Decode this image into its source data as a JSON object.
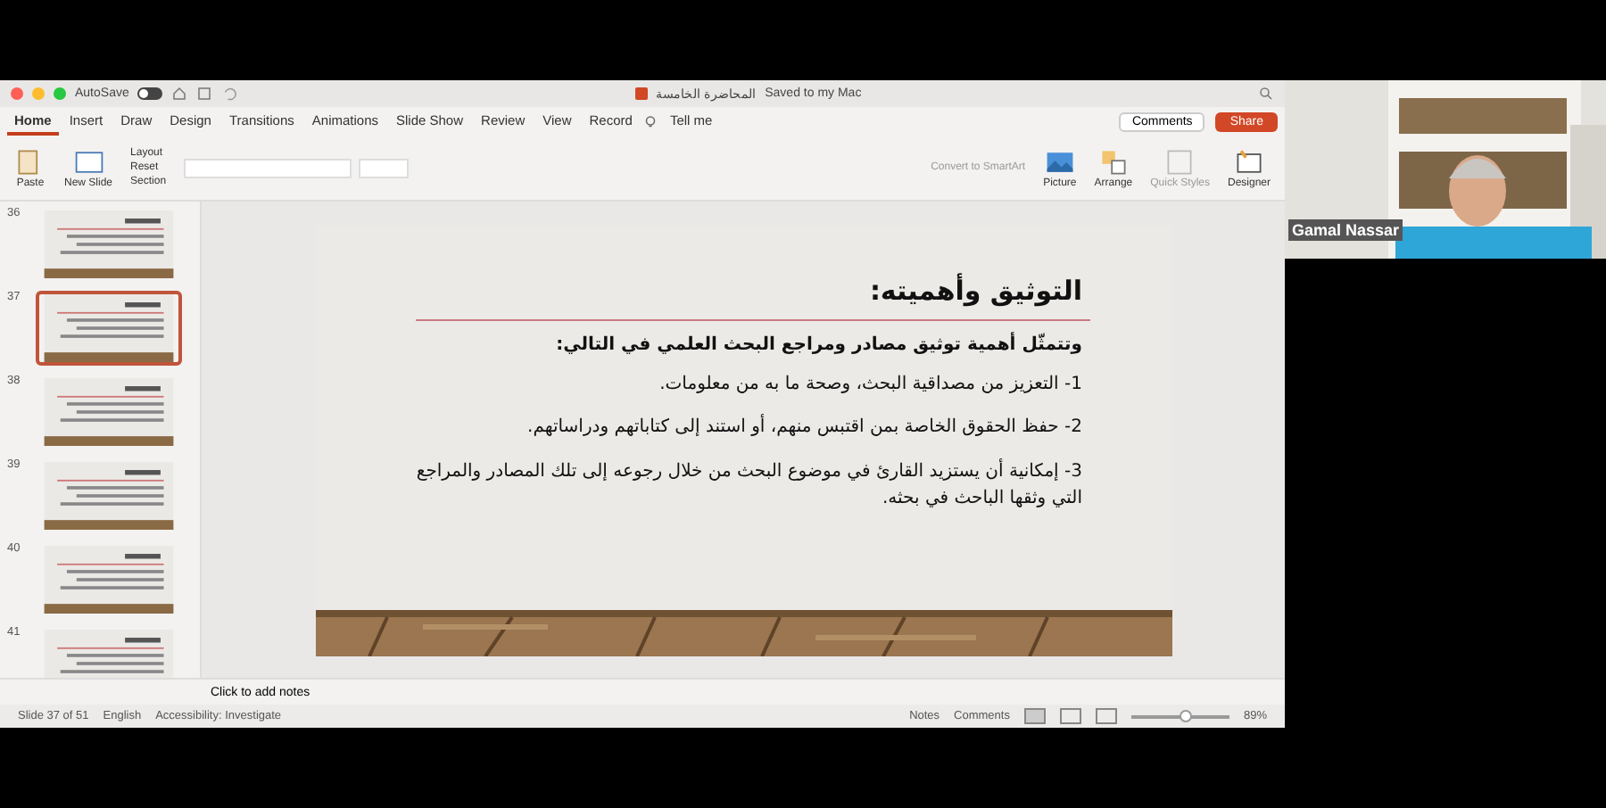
{
  "window": {
    "title": "المحاضرة الخامسة",
    "save_status": "Saved to my Mac",
    "autosave_label": "AutoSave",
    "autosave_on": false
  },
  "tabs": [
    {
      "label": "Home",
      "selected": true
    },
    {
      "label": "Insert",
      "selected": false
    },
    {
      "label": "Draw",
      "selected": false
    },
    {
      "label": "Design",
      "selected": false
    },
    {
      "label": "Transitions",
      "selected": false
    },
    {
      "label": "Animations",
      "selected": false
    },
    {
      "label": "Slide Show",
      "selected": false
    },
    {
      "label": "Review",
      "selected": false
    },
    {
      "label": "View",
      "selected": false
    },
    {
      "label": "Record",
      "selected": false
    }
  ],
  "tell_me": "Tell me",
  "comments_button": "Comments",
  "share_button": "Share",
  "ribbon": {
    "paste": "Paste",
    "new_slide": "New Slide",
    "slide_menu": [
      "Layout",
      "Reset",
      "Section"
    ],
    "smartart": "Convert to SmartArt",
    "picture": "Picture",
    "arrange": "Arrange",
    "quick_styles": "Quick Styles",
    "designer": "Designer"
  },
  "thumbnails": [
    {
      "number": "36",
      "selected": false
    },
    {
      "number": "37",
      "selected": true
    },
    {
      "number": "38",
      "selected": false
    },
    {
      "number": "39",
      "selected": false
    },
    {
      "number": "40",
      "selected": false
    },
    {
      "number": "41",
      "selected": false
    }
  ],
  "slide": {
    "title": "التوثيق وأهميته:",
    "intro": "وتتمثّل أهمية توثيق مصادر ومراجع البحث العلمي في التالي:",
    "points": [
      "1- التعزيز من مصداقية البحث، وصحة ما به من معلومات.",
      "2- حفظ الحقوق الخاصة بمن اقتبس منهم، أو استند إلى كتاباتهم ودراساتهم.",
      "3- إمكانية أن يستزيد القارئ في موضوع البحث من خلال رجوعه إلى تلك المصادر والمراجع التي وثقها الباحث في بحثه."
    ]
  },
  "notes_placeholder": "Click to add notes",
  "status_bar": {
    "slide": "Slide 37 of 51",
    "language": "English",
    "accessibility": "Accessibility: Investigate",
    "notes": "Notes",
    "comments": "Comments",
    "zoom": {
      "level": 0.55
    },
    "zoom_text": "89%"
  },
  "webcam": {
    "name": "Gamal Nassar"
  }
}
